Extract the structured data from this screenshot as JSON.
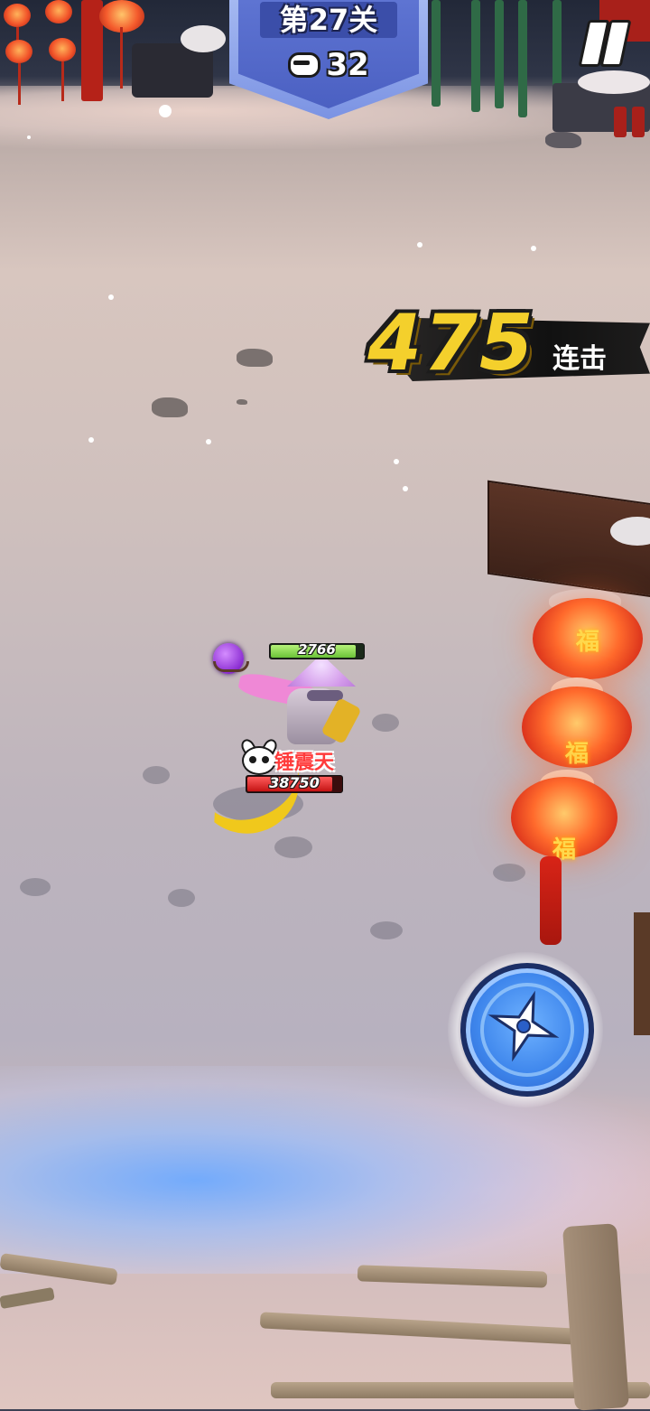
{
  "hud": {
    "level_title": "第27关",
    "enemy_count": "32",
    "pause_icon": "pause-icon",
    "banner_color": "#5e74d2"
  },
  "combo": {
    "count": "475",
    "label": "连击",
    "number_color": "#f4d02c"
  },
  "player": {
    "hp": "2766",
    "hp_fraction": 0.92,
    "orb_icon": "purple-orb-icon"
  },
  "boss": {
    "name": "锤震天",
    "hp": "38750",
    "hp_fraction": 0.9,
    "icon": "demon-skull-icon"
  },
  "lanterns": {
    "character": "福"
  },
  "skill": {
    "icon": "shuriken-icon"
  }
}
